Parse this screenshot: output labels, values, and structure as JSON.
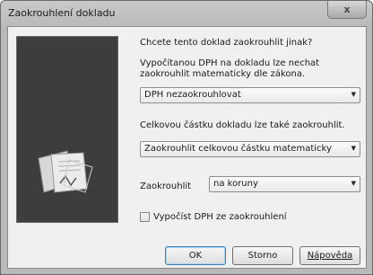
{
  "window": {
    "title": "Zaokrouhlení dokladu",
    "close_label": "x"
  },
  "content": {
    "question": "Chcete tento doklad zaokrouhlit jinak?",
    "vat_text": "Vypočítanou DPH na dokladu lze nechat\nzaokrouhlit matematicky dle zákona.",
    "vat_select": "DPH nezaokrouhlovat",
    "total_text": "Celkovou částku dokladu lze také zaokrouhlit.",
    "total_select": "Zaokrouhlit celkovou částku matematicky",
    "round_label": "Zaokrouhlit",
    "round_select": "na koruny",
    "checkbox_label": "Vypočíst DPH ze zaokrouhlení",
    "checkbox_checked": false
  },
  "buttons": {
    "ok": "OK",
    "cancel": "Storno",
    "help": "Nápověda"
  }
}
